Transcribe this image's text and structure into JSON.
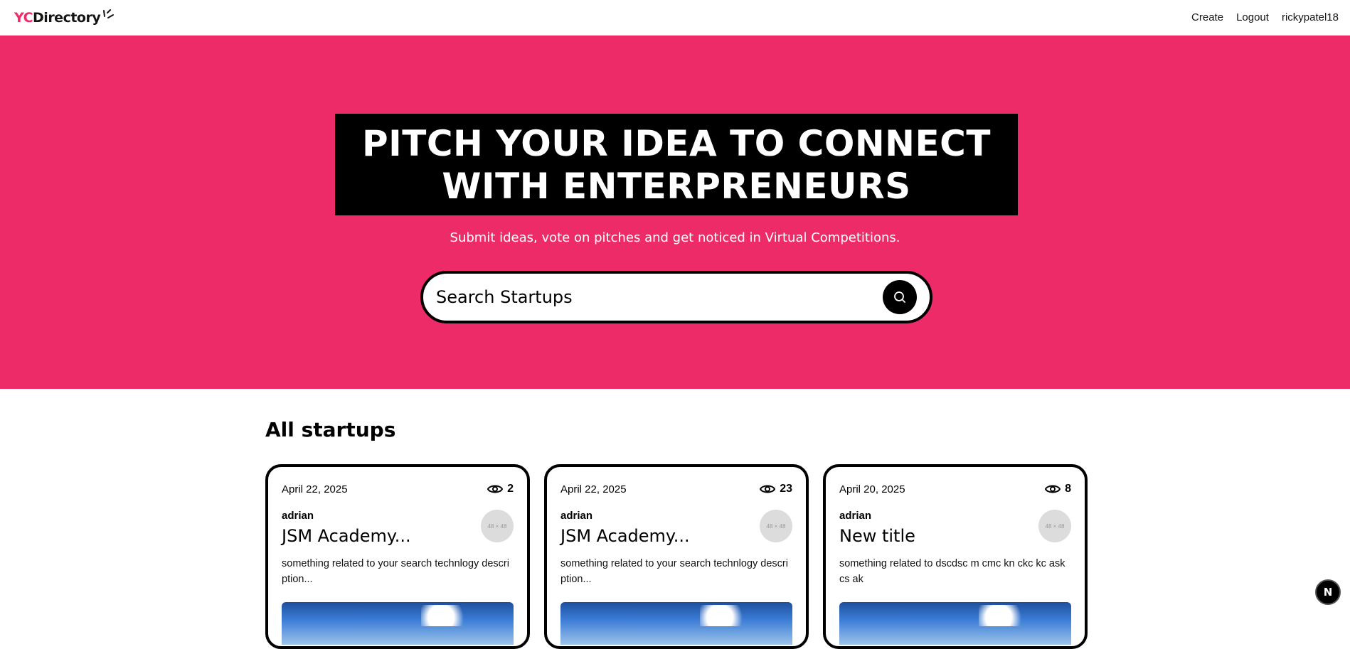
{
  "nav": {
    "logo_yc": "YC",
    "logo_directory": "Directory",
    "links": [
      "Create",
      "Logout",
      "rickypatel18"
    ]
  },
  "hero": {
    "title_line1": "PITCH YOUR IDEA TO CONNECT",
    "title_line2": "WITH ENTERPRENEURS",
    "subtitle": "Submit ideas, vote on pitches and get noticed in Virtual Competitions.",
    "search_placeholder": "Search Startups"
  },
  "section": {
    "title": "All startups"
  },
  "cards": [
    {
      "date": "April 22, 2025",
      "views": "2",
      "author": "adrian",
      "title": "JSM Academy...",
      "avatar_text": "48 × 48",
      "description": "something related to your search technlogy description..."
    },
    {
      "date": "April 22, 2025",
      "views": "23",
      "author": "adrian",
      "title": "JSM Academy...",
      "avatar_text": "48 × 48",
      "description": "something related to your search technlogy description..."
    },
    {
      "date": "April 20, 2025",
      "views": "8",
      "author": "adrian",
      "title": "New title",
      "avatar_text": "48 × 48",
      "description": "something related to dscdsc m cmc kn ckc kc ask cs ak"
    }
  ],
  "fab": {
    "label": "N"
  },
  "colors": {
    "primary": "#ee2b69",
    "black": "#000000"
  },
  "icons": {
    "search": "search-icon",
    "views": "eye-icon"
  }
}
